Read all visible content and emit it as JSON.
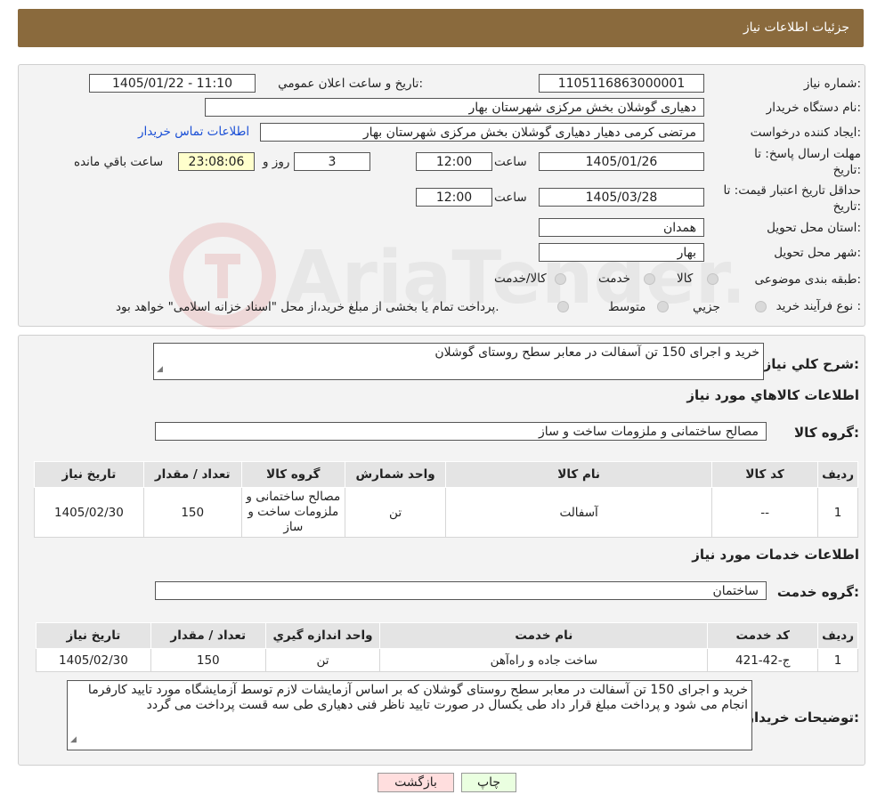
{
  "header": {
    "title": "جزئیات اطلاعات نیاز"
  },
  "form": {
    "need_number_label": "شماره نیاز:",
    "need_number": "1105116863000001",
    "announce_label": "تاریخ و ساعت اعلان عمومي:",
    "announce_value": "1405/01/22 - 11:10",
    "buyer_org_label": "نام دستگاه خريدار:",
    "buyer_org": "دهیاری گوشلان بخش مرکزی شهرستان بهار",
    "creator_label": "ايجاد کننده درخواست:",
    "creator": "مرتضی کرمی دهیار دهیاری گوشلان بخش مرکزی شهرستان بهار",
    "contact_link": "اطلاعات تماس خريدار",
    "deadline_label_1": "مهلت ارسال پاسخ: تا",
    "deadline_label_2": "تاريخ:",
    "deadline_date": "1405/01/26",
    "time_label": "ساعت",
    "deadline_time": "12:00",
    "days_value": "3",
    "days_label": "روز و",
    "remaining_value": "23:08:06",
    "remaining_label": "ساعت باقي مانده",
    "validity_label_1": "حداقل تاريخ اعتبار قيمت: تا",
    "validity_label_2": "تاريخ:",
    "validity_date": "1405/03/28",
    "validity_time": "12:00",
    "province_label": "استان محل تحويل:",
    "province": "همدان",
    "city_label": "شهر محل تحويل:",
    "city": "بهار",
    "category_label": "طبقه بندی موضوعی:",
    "category_options": [
      "کالا",
      "خدمت",
      "کالا/خدمت"
    ],
    "process_label": "نوع فرآيند خريد :",
    "process_options": [
      "جزيي",
      "متوسط"
    ],
    "process_note": "پرداخت تمام يا بخشی از مبلغ خريد،از محل \"اسناد خزانه اسلامی\" خواهد بود."
  },
  "summary": {
    "label": "شرح کلي نياز:",
    "text": "خرید و اجرای 150 تن آسفالت در معابر سطح روستای گوشلان"
  },
  "goods": {
    "section_title": "اطلاعات کالاهاي مورد نياز",
    "group_label": "گروه کالا:",
    "group_value": "مصالح ساختمانی و ملزومات ساخت و ساز",
    "columns": [
      "رديف",
      "کد کالا",
      "نام کالا",
      "واحد شمارش",
      "گروه کالا",
      "تعداد / مقدار",
      "تاريخ نياز"
    ],
    "rows": [
      {
        "index": "1",
        "code": "--",
        "name": "آسفالت",
        "unit": "تن",
        "group": "مصالح ساختمانی و ملزومات ساخت و ساز",
        "qty": "150",
        "date": "1405/02/30"
      }
    ]
  },
  "services": {
    "section_title": "اطلاعات خدمات مورد نياز",
    "group_label": "گروه خدمت:",
    "group_value": "ساختمان",
    "columns": [
      "رديف",
      "کد خدمت",
      "نام خدمت",
      "واحد اندازه گيري",
      "تعداد / مقدار",
      "تاريخ نياز"
    ],
    "rows": [
      {
        "index": "1",
        "code": "ج-42-421",
        "name": "ساخت جاده و راه‌آهن",
        "unit": "تن",
        "qty": "150",
        "date": "1405/02/30"
      }
    ]
  },
  "buyer_notes": {
    "label": "توضيحات خريدار:",
    "text": "خرید و اجرای 150 تن آسفالت در معابر سطح روستای گوشلان که بر اساس آزمایشات لازم توسط آزمایشگاه مورد تایید کارفرما انجام می شود و پرداخت مبلغ قرار داد طی یکسال در صورت تایید ناظر فنی دهیاری طی سه قست پرداخت می گردد"
  },
  "buttons": {
    "print": "چاپ",
    "back": "بازگشت"
  },
  "watermark": {
    "text": "AriaTender.neT"
  },
  "colors": {
    "header_bg": "#8a6a3d",
    "link": "#1a4fd6",
    "back_button": "#ffdede",
    "print_button": "#eaffe0",
    "remaining_bg": "#ffffcc"
  }
}
